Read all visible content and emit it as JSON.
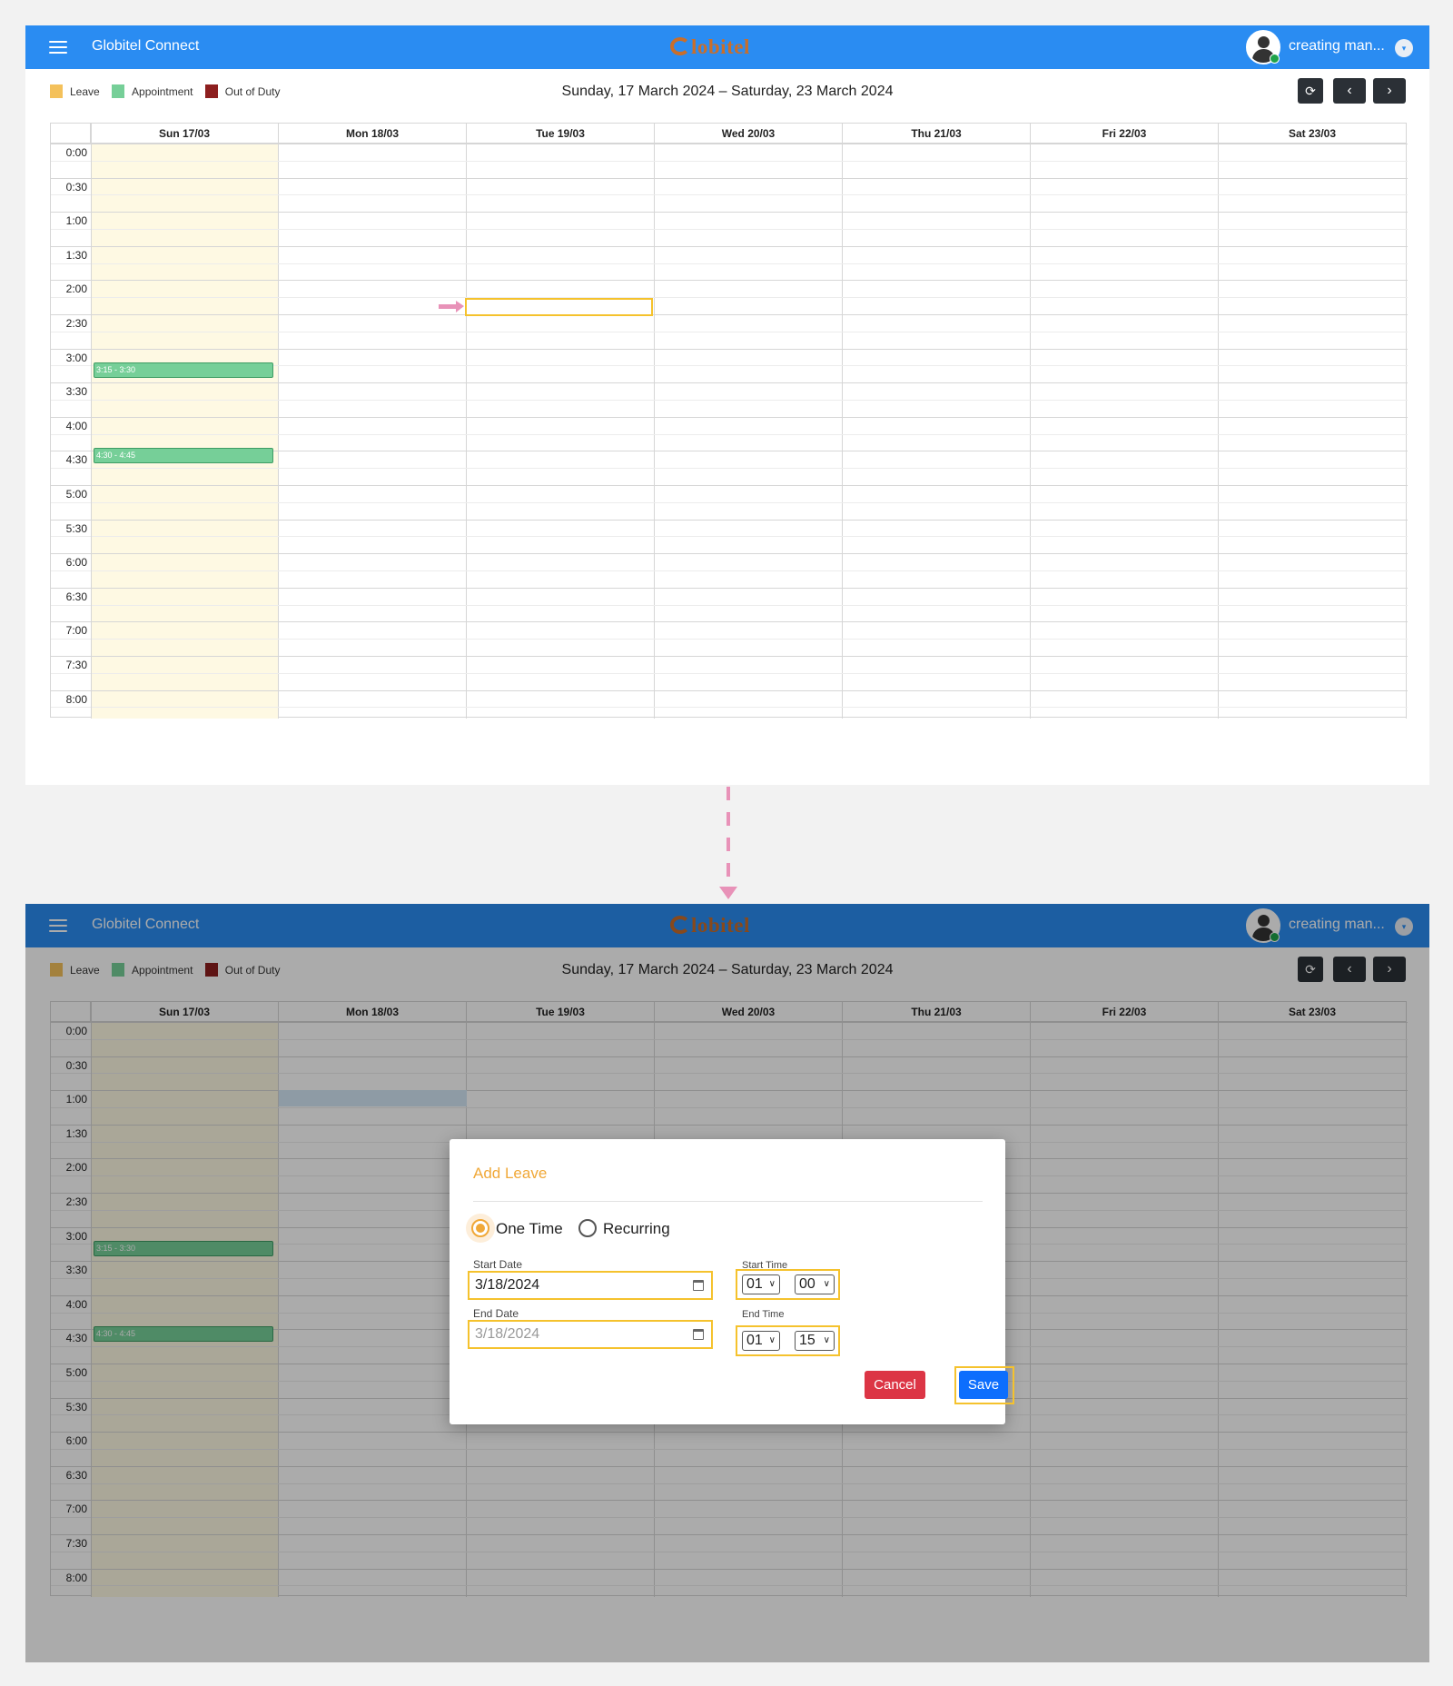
{
  "appbar": {
    "title": "Globitel Connect",
    "logo": "lobitel",
    "user_name": "creating man...",
    "caret": "▾"
  },
  "legend": [
    {
      "label": "Leave",
      "color": "#f4c15b"
    },
    {
      "label": "Appointment",
      "color": "#76cf98"
    },
    {
      "label": "Out of Duty",
      "color": "#8d1f1f"
    }
  ],
  "range_title": "Sunday, 17 March 2024 – Saturday, 23 March 2024",
  "nav": {
    "refresh": "⟳",
    "prev": "‹",
    "next": "›"
  },
  "days": [
    "Sun 17/03",
    "Mon 18/03",
    "Tue 19/03",
    "Wed 20/03",
    "Thu 21/03",
    "Fri 22/03",
    "Sat 23/03"
  ],
  "times": [
    "0:00",
    "0:30",
    "1:00",
    "1:30",
    "2:00",
    "2:30",
    "3:00",
    "3:30",
    "4:00",
    "4:30",
    "5:00",
    "5:30",
    "6:00",
    "6:30",
    "7:00",
    "7:30",
    "8:00"
  ],
  "events": [
    {
      "label": "3:15 - 3:30",
      "start": 3.25
    },
    {
      "label": "4:30 - 4:45",
      "start": 4.5
    }
  ],
  "modal": {
    "title": "Add Leave",
    "radio_one_time": "One Time",
    "radio_recurring": "Recurring",
    "start_date_label": "Start Date",
    "start_date_value": "3/18/2024",
    "end_date_label": "End Date",
    "end_date_value": "3/18/2024",
    "start_time_label": "Start Time",
    "start_hour": "01",
    "start_minute": "00",
    "end_time_label": "End Time",
    "end_hour": "01",
    "end_minute": "15",
    "cancel": "Cancel",
    "save": "Save"
  }
}
